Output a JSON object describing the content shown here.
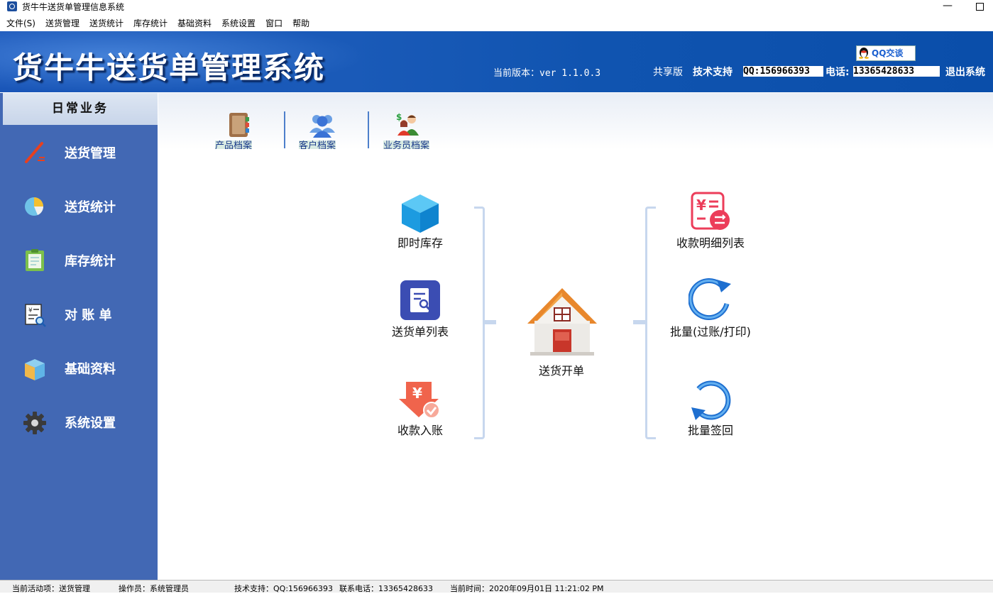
{
  "window": {
    "title": "货牛牛送货单管理信息系统",
    "minimize": "—"
  },
  "menu": [
    "文件(S)",
    "送货管理",
    "送货统计",
    "库存统计",
    "基础资料",
    "系统设置",
    "窗口",
    "帮助"
  ],
  "header": {
    "banner_title": "货牛牛送货单管理系统",
    "version": "当前版本：ver 1.1.0.3",
    "edition": "共享版",
    "support_label": "技术支持",
    "support_qq": "QQ:156966393",
    "phone_label": "电话:",
    "support_phone": "13365428633",
    "logout": "退出系统",
    "qq_chat": "QQ交谈"
  },
  "sidebar": {
    "heading": "日常业务",
    "items": [
      {
        "label": "送货管理",
        "icon": "pencil-icon"
      },
      {
        "label": "送货统计",
        "icon": "pie-chart-icon"
      },
      {
        "label": "库存统计",
        "icon": "clipboard-icon"
      },
      {
        "label": "对 账 单",
        "icon": "statement-search-icon"
      },
      {
        "label": "基础资料",
        "icon": "box-icon"
      },
      {
        "label": "系统设置",
        "icon": "gear-icon"
      }
    ]
  },
  "quick_access": [
    {
      "label": "产品档案",
      "icon": "book-icon"
    },
    {
      "label": "客户档案",
      "icon": "users-icon"
    },
    {
      "label": "业务员档案",
      "icon": "salesman-icon"
    }
  ],
  "functions": {
    "instant_stock": "即时库存",
    "delivery_list": "送货单列表",
    "payment_entry": "收款入账",
    "create_delivery": "送货开单",
    "payment_detail": "收款明细列表",
    "batch_post": "批量(过账/打印)",
    "batch_sign": "批量签回"
  },
  "status": {
    "active_item": "当前活动项：送货管理",
    "operator": "操作员：系统管理员",
    "support": "技术支持：QQ:156966393",
    "phone": "联系电话：13365428633",
    "time": "当前时间：2020年09月01日 11:21:02 PM"
  },
  "colors": {
    "header": "#1a56b8",
    "sidebar": "#4268b4",
    "accent": "#c7d7ee"
  }
}
